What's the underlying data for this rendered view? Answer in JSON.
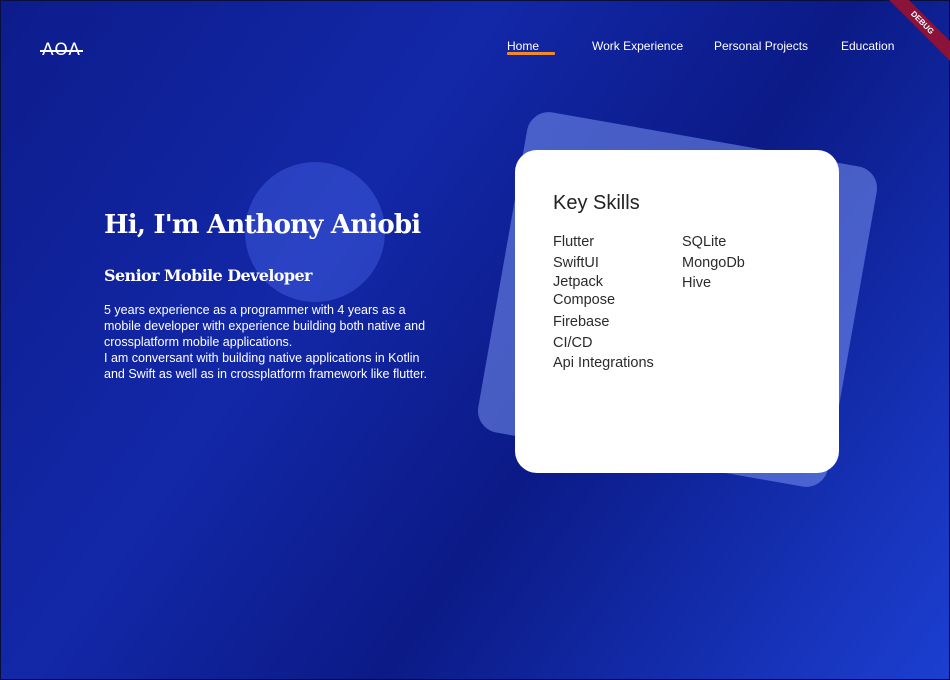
{
  "brand": {
    "logo_text": "AOA"
  },
  "nav": {
    "items": [
      {
        "label": "Home"
      },
      {
        "label": "Work Experience"
      },
      {
        "label": "Personal Projects"
      },
      {
        "label": "Education"
      }
    ],
    "active_color": "#f08a2a"
  },
  "hero": {
    "name": "Hi, I'm Anthony Aniobi",
    "role": "Senior Mobile Developer",
    "bio": "5 years experience as a programmer with 4 years as a mobile developer with experience building both native and crossplatform mobile applications.\nI am conversant with building native applications in Kotlin and Swift as well as in crossplatform framework like flutter."
  },
  "skills": {
    "title": "Key Skills",
    "col1": [
      "Flutter",
      "SwiftUI",
      "Jetpack Compose",
      "Firebase",
      "CI/CD",
      "Api Integrations"
    ],
    "col2": [
      "SQLite",
      "MongoDb",
      "Hive"
    ]
  },
  "debug_banner": "DEBUG",
  "colors": {
    "background_start": "#0d1c8c",
    "background_end": "#1c3fd2",
    "debug_banner": "#8b1238"
  }
}
